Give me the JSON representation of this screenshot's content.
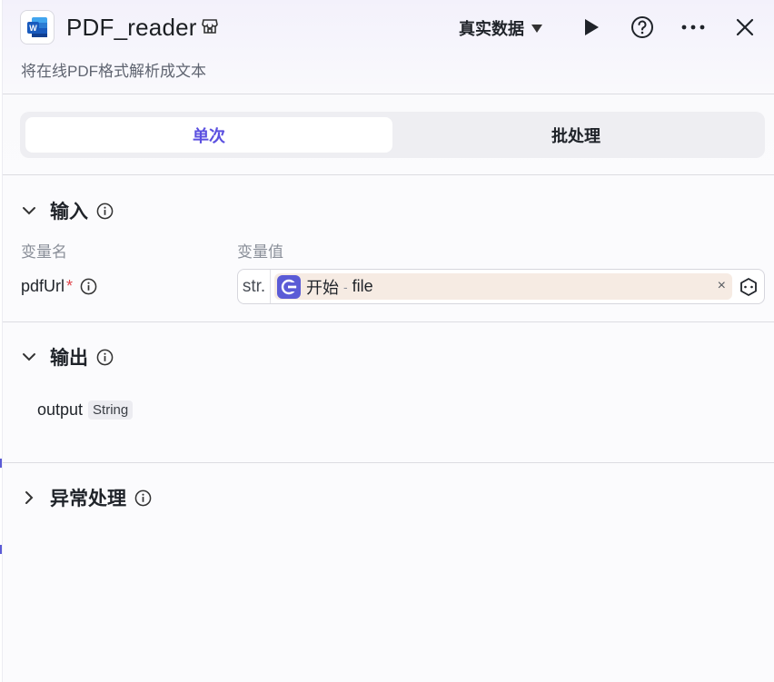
{
  "header": {
    "app_icon": "word-doc-icon",
    "title": "PDF_reader",
    "description": "将在线PDF格式解析成文本",
    "mode_select_label": "真实数据",
    "actions": [
      "run-icon",
      "help-icon",
      "more-icon",
      "close-icon"
    ]
  },
  "tabs": [
    {
      "label": "单次",
      "active": true
    },
    {
      "label": "批处理",
      "active": false
    }
  ],
  "input_section": {
    "title": "输入",
    "col_name": "变量名",
    "col_value": "变量值",
    "params": [
      {
        "name": "pdfUrl",
        "required_mark": "*",
        "type_tag": "str.",
        "ref_node": "开始",
        "ref_sep": "-",
        "ref_field": "file",
        "clear_glyph": "×"
      }
    ]
  },
  "output_section": {
    "title": "输出",
    "outputs": [
      {
        "name": "output",
        "type": "String"
      }
    ]
  },
  "exception_section": {
    "title": "异常处理"
  },
  "colors": {
    "accent": "#5b50e0",
    "ref_chip_bg": "#f6ebe3",
    "ref_icon_bg": "#5b5bd6",
    "required": "#e0444b"
  }
}
